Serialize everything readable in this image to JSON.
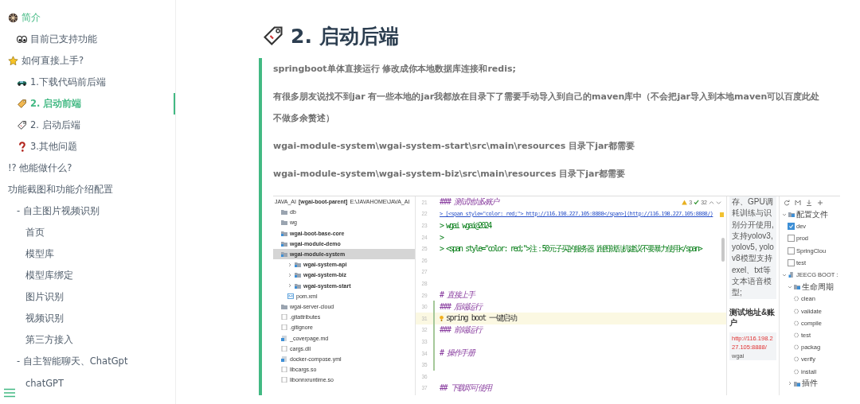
{
  "sidebar": {
    "items": [
      {
        "text": "简介",
        "kind": "wheel",
        "active": true,
        "selected": false,
        "children": [
          {
            "text": "目前已支持功能",
            "kind": "eyes",
            "active": false,
            "selected": false
          }
        ]
      },
      {
        "text": "如何直接上手?",
        "kind": "star",
        "active": false,
        "selected": false,
        "children": [
          {
            "text": "1.下载代码前后端",
            "kind": "car",
            "active": false,
            "selected": false
          },
          {
            "text": "2. 启动前端",
            "kind": "tag",
            "active": true,
            "selected": true
          },
          {
            "text": "2. 启动后端",
            "kind": "label",
            "active": false,
            "selected": false
          },
          {
            "text": "3.其他问题",
            "kind": "question",
            "active": false,
            "selected": false
          }
        ]
      },
      {
        "text": "!? 他能做什么?",
        "active": false,
        "selected": false
      },
      {
        "text": "功能截图和功能介绍配置",
        "active": false,
        "selected": false,
        "children": [
          {
            "text": "- 自主图片视频识别",
            "active": false,
            "selected": false,
            "children": [
              {
                "text": "首页",
                "active": false,
                "selected": false
              },
              {
                "text": "模型库",
                "active": false,
                "selected": false
              },
              {
                "text": "模型库绑定",
                "active": false,
                "selected": false
              },
              {
                "text": "图片识别",
                "active": false,
                "selected": false
              },
              {
                "text": "视频识别",
                "active": false,
                "selected": false
              },
              {
                "text": "第三方接入",
                "active": false,
                "selected": false
              }
            ]
          },
          {
            "text": "- 自主智能聊天、ChatGpt",
            "active": false,
            "selected": false,
            "children": [
              {
                "text": "chatGPT",
                "active": false,
                "selected": false
              }
            ]
          }
        ]
      }
    ]
  },
  "page": {
    "heading": "2. 启动后端",
    "paragraphs": [
      "springboot单体直接运行 修改成你本地数据库连接和redis;",
      "有很多朋友说找不到jar 有一些本地的jar我都放在目录下了需要手动导入到自己的maven库中（不会把jar导入到本地maven可以百度此处不做多余赘述）",
      "wgai-module-system\\wgai-system-start\\src\\main\\resources 目录下jar都需要",
      "wgai-module-system\\wgai-system-biz\\src\\main\\resources 目录下jar都需要"
    ],
    "screenshot": {
      "project": {
        "root": "JAVA_AI **[wgai-boot-parent]** E:\\JAVAHOME\\JAVA_AI",
        "items": [
          {
            "text": "db",
            "kind": "folder",
            "selected": false
          },
          {
            "text": "wg",
            "kind": "folder",
            "selected": false
          },
          {
            "text": "wgai-boot-base-core",
            "kind": "module",
            "selected": false
          },
          {
            "text": "wgai-module-demo",
            "kind": "module",
            "selected": false
          },
          {
            "text": "wgai-module-system",
            "kind": "module",
            "selected": true,
            "children": [
              {
                "text": "wgai-system-api",
                "kind": "module",
                "selected": false,
                "expanded": false
              },
              {
                "text": "wgai-system-biz",
                "kind": "module",
                "selected": false,
                "expanded": false
              },
              {
                "text": "wgai-system-start",
                "kind": "module",
                "selected": false,
                "expanded": false
              },
              {
                "text": "pom.xml",
                "kind": "xml",
                "selected": false
              }
            ]
          },
          {
            "text": "wgai-server-cloud",
            "kind": "folder",
            "selected": false
          },
          {
            "text": ".gitattributes",
            "kind": "file",
            "selected": false
          },
          {
            "text": ".gitignore",
            "kind": "file",
            "selected": false
          },
          {
            "text": "_coverpage.md",
            "kind": "markdown",
            "selected": false
          },
          {
            "text": "cargs.dll",
            "kind": "file",
            "selected": false
          },
          {
            "text": "docker-compose.yml",
            "kind": "markdown",
            "selected": false
          },
          {
            "text": "libcargs.so",
            "kind": "file",
            "selected": false
          },
          {
            "text": "libonnxruntime.so",
            "kind": "file",
            "selected": false
          }
        ]
      },
      "editor": {
        "warnings": "3",
        "checks": "32",
        "lines": [
          {
            "number": "21",
            "kind": "heading",
            "text": "### 测试地址&账户",
            "current": false,
            "changed": false
          },
          {
            "number": "22",
            "kind": "link",
            "text": "> [<span style=\"color: red;\"> http://116.198.227.105:8888</span>](http://116.198.227.105:8888/)",
            "current": false,
            "changed": false
          },
          {
            "number": "23",
            "kind": "quote",
            "text": "> wgai wgai@2024",
            "current": false,
            "changed": false
          },
          {
            "number": "24",
            "kind": "quote",
            "text": ">",
            "current": false,
            "changed": false
          },
          {
            "number": "25",
            "kind": "quote",
            "text": "> <span style=\"color: red;\">注：50元子买的服务器 跑图就乱机建议不要暴力使用</span>",
            "current": false,
            "changed": false
          },
          {
            "number": "26",
            "kind": "empty",
            "current": false,
            "changed": false
          },
          {
            "number": "27",
            "kind": "empty",
            "current": false,
            "changed": false
          },
          {
            "number": "28",
            "kind": "empty",
            "current": false,
            "changed": false
          },
          {
            "number": "29",
            "kind": "heading",
            "text": "# 直接上手",
            "current": false,
            "changed": false
          },
          {
            "number": "30",
            "kind": "heading",
            "text": "### 后端运行",
            "current": false,
            "changed": true
          },
          {
            "number": "31",
            "kind": "plain",
            "text": "spring boot 一键启动",
            "current": true,
            "changed": true
          },
          {
            "number": "32",
            "kind": "heading",
            "text": "### 前端运行",
            "current": false,
            "changed": true
          },
          {
            "number": "33",
            "kind": "empty",
            "current": false,
            "changed": true
          },
          {
            "number": "34",
            "kind": "heading",
            "text": "# 操作手册",
            "current": false,
            "changed": true
          },
          {
            "number": "35",
            "kind": "empty",
            "current": false,
            "changed": true
          },
          {
            "number": "36",
            "kind": "empty",
            "current": false,
            "changed": false
          },
          {
            "number": "37",
            "kind": "heading",
            "text": "## 下载即可使用",
            "current": false,
            "changed": false
          }
        ]
      },
      "preview": {
        "paragraph": "存、GPU调耗训练与识别分开使用,支持yolov3, yolov5, yolov8模型支持exel、txt等文本语音模型;",
        "heading": "测试地址&账户",
        "account": [
          {
            "kind": "link",
            "text": "http://116.198.227.105:8888/"
          },
          {
            "kind": "plain",
            "text": "wgai"
          }
        ]
      },
      "maven": {
        "items": [
          {
            "text": "配置文件",
            "kind": "folder",
            "expanded": true,
            "children": [
              {
                "text": "dev",
                "kind": "profile",
                "checked": true
              },
              {
                "text": "prod",
                "kind": "profile",
                "checked": false
              },
              {
                "text": "SpringClou",
                "kind": "profile",
                "checked": false
              },
              {
                "text": "test",
                "kind": "profile",
                "checked": false
              }
            ]
          },
          {
            "text": "JEECG BOOT :",
            "kind": "project",
            "expanded": true,
            "children": [
              {
                "text": "生命周期",
                "kind": "folder",
                "expanded": true,
                "children": [
                  {
                    "text": "clean",
                    "kind": "goal"
                  },
                  {
                    "text": "validate",
                    "kind": "goal"
                  },
                  {
                    "text": "compile",
                    "kind": "goal"
                  },
                  {
                    "text": "test",
                    "kind": "goal"
                  },
                  {
                    "text": "packag",
                    "kind": "goal"
                  },
                  {
                    "text": "verify",
                    "kind": "goal"
                  },
                  {
                    "text": "install",
                    "kind": "goal"
                  }
                ]
              },
              {
                "text": "插件",
                "kind": "folder",
                "expanded": false
              }
            ]
          }
        ]
      }
    }
  }
}
